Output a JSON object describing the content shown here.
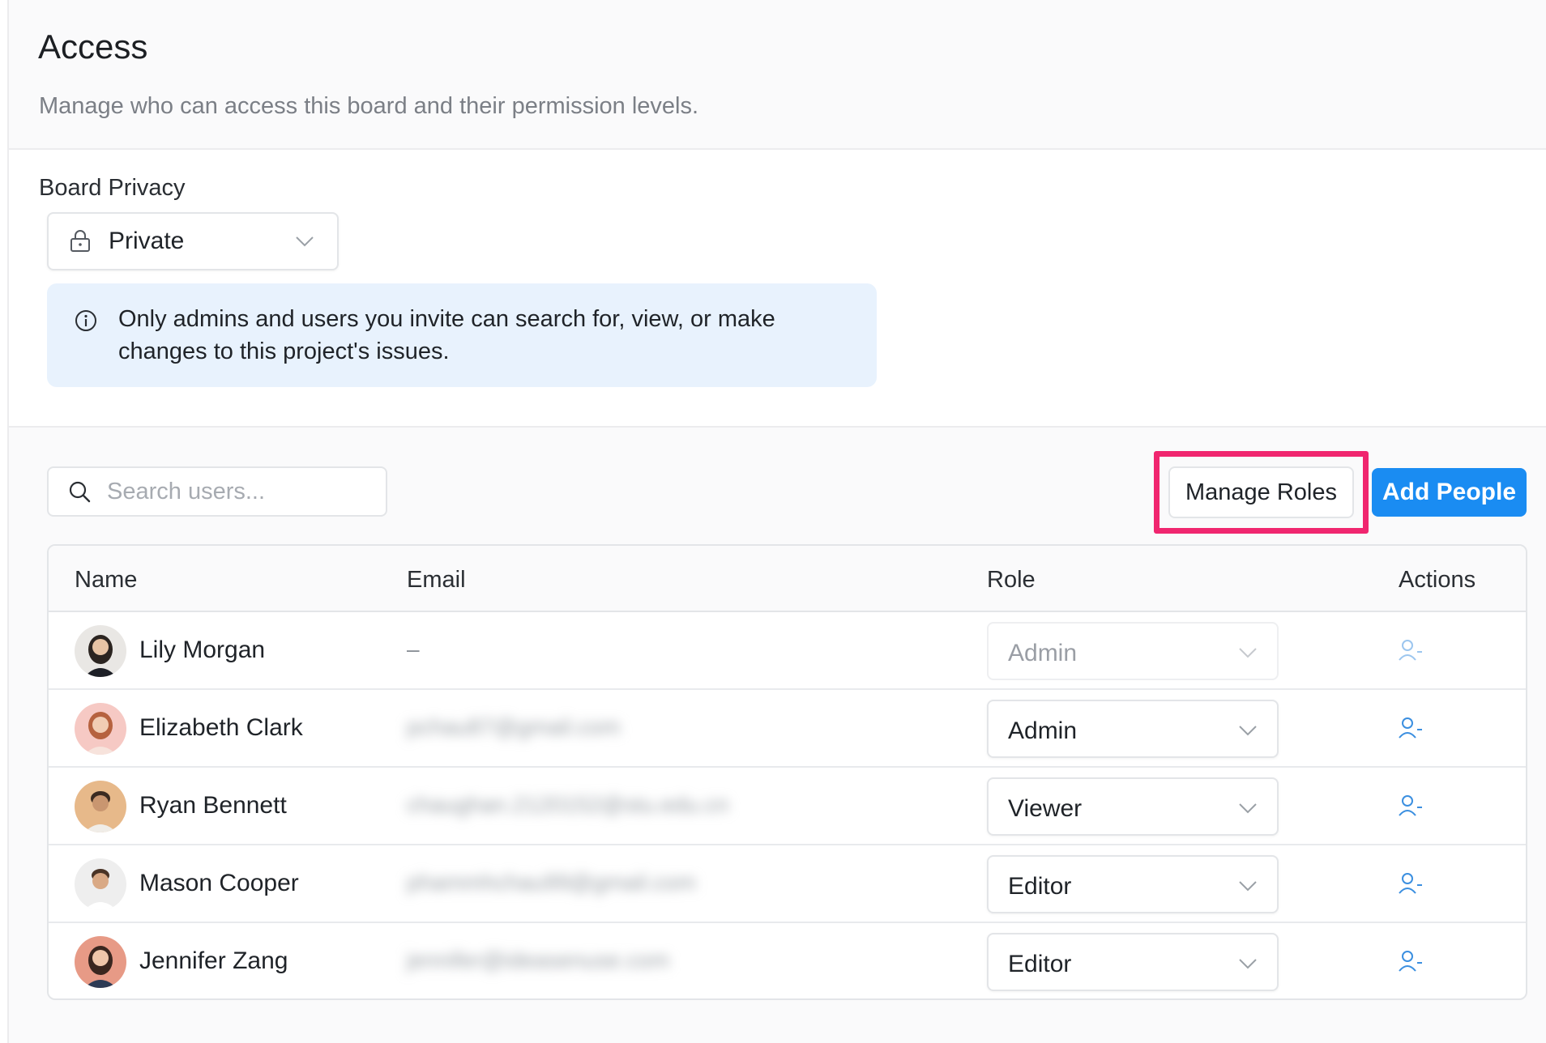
{
  "header": {
    "title": "Access",
    "subtitle": "Manage who can access this board and their permission levels."
  },
  "privacy": {
    "label": "Board Privacy",
    "selected": "Private",
    "info": "Only admins and users you invite can search for, view, or make changes to this project's issues."
  },
  "toolbar": {
    "search_placeholder": "Search users...",
    "manage_roles_label": "Manage Roles",
    "add_people_label": "Add People"
  },
  "table": {
    "columns": [
      "Name",
      "Email",
      "Role",
      "Actions"
    ],
    "rows": [
      {
        "name": "Lily Morgan",
        "email": "–",
        "role": "Admin"
      },
      {
        "name": "Elizabeth Clark",
        "email": "pchau87@gmail.com",
        "role": "Admin"
      },
      {
        "name": "Ryan Bennett",
        "email": "chaughan.2120152@stu.edu.cn",
        "role": "Viewer"
      },
      {
        "name": "Mason Cooper",
        "email": "phammhchau99@gmail.com",
        "role": "Editor"
      },
      {
        "name": "Jennifer Zang",
        "email": "jennifer@ideasenuse.com",
        "role": "Editor"
      }
    ]
  },
  "colors": {
    "accent": "#1a8cf2",
    "highlight": "#f0266f",
    "info_bg": "#e8f2fd",
    "remove_icon": "#3b8fe0"
  }
}
